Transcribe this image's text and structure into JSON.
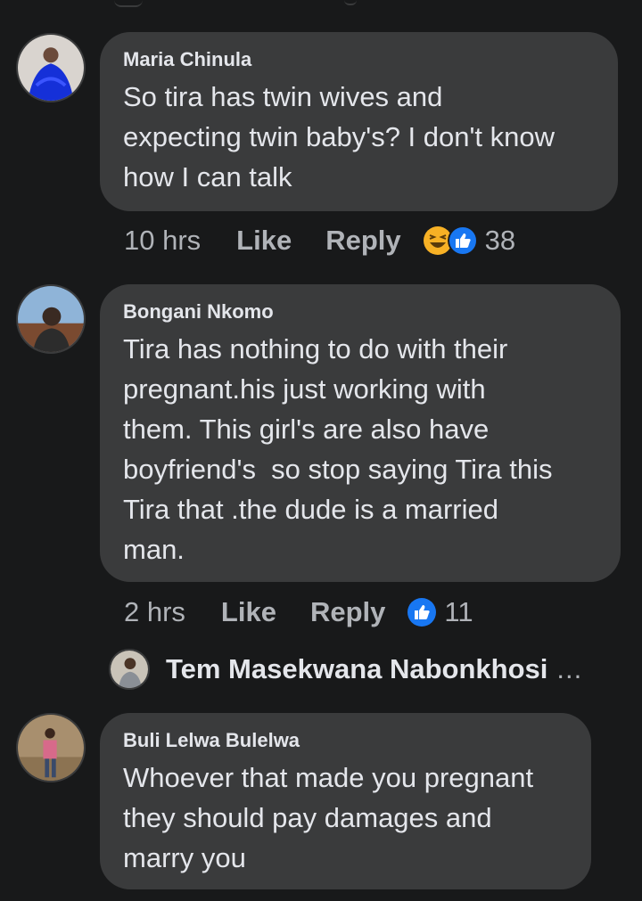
{
  "comments": [
    {
      "author": "Maria Chinula",
      "text": "So tira has twin wives and\nexpecting twin baby's? I don't know\nhow I can talk",
      "time": "10 hrs",
      "like_label": "Like",
      "reply_label": "Reply",
      "reactions": [
        "haha",
        "like"
      ],
      "reaction_count": "38"
    },
    {
      "author": "Bongani Nkomo",
      "text": "Tira has nothing to do with their\npregnant.his just working with\nthem. This girl's are also have\nboyfriend's  so stop saying Tira this\nTira that .the dude is a married\nman.",
      "time": "2 hrs",
      "like_label": "Like",
      "reply_label": "Reply",
      "reactions": [
        "like"
      ],
      "reaction_count": "11"
    },
    {
      "author": "Buli Lelwa Bulelwa",
      "text": "Whoever that made you pregnant\nthey should pay damages and\nmarry you"
    }
  ],
  "reply_preview": {
    "author": "Tem Masekwana Nabonkhosi",
    "more": "..."
  },
  "colors": {
    "background": "#18191a",
    "bubble": "#3a3b3c",
    "primary_text": "#e4e6eb",
    "secondary_text": "#b0b3b8",
    "like_blue": "#1877f2",
    "haha_yellow": "#f7b125"
  }
}
